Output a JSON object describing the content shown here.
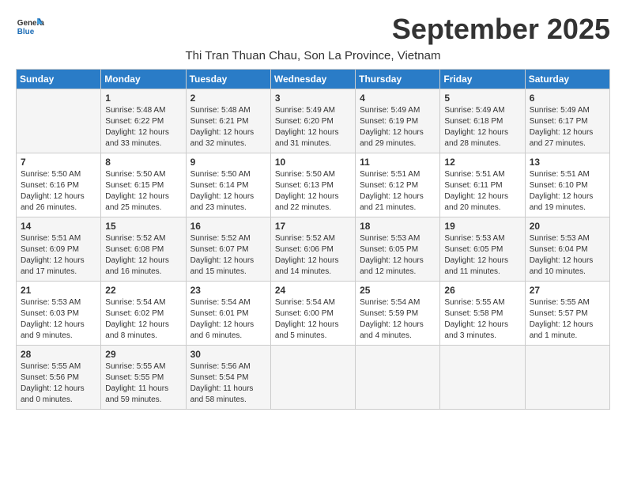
{
  "logo": {
    "line1": "General",
    "line2": "Blue"
  },
  "title": "September 2025",
  "location": "Thi Tran Thuan Chau, Son La Province, Vietnam",
  "days_of_week": [
    "Sunday",
    "Monday",
    "Tuesday",
    "Wednesday",
    "Thursday",
    "Friday",
    "Saturday"
  ],
  "weeks": [
    [
      {
        "day": "",
        "info": ""
      },
      {
        "day": "1",
        "info": "Sunrise: 5:48 AM\nSunset: 6:22 PM\nDaylight: 12 hours\nand 33 minutes."
      },
      {
        "day": "2",
        "info": "Sunrise: 5:48 AM\nSunset: 6:21 PM\nDaylight: 12 hours\nand 32 minutes."
      },
      {
        "day": "3",
        "info": "Sunrise: 5:49 AM\nSunset: 6:20 PM\nDaylight: 12 hours\nand 31 minutes."
      },
      {
        "day": "4",
        "info": "Sunrise: 5:49 AM\nSunset: 6:19 PM\nDaylight: 12 hours\nand 29 minutes."
      },
      {
        "day": "5",
        "info": "Sunrise: 5:49 AM\nSunset: 6:18 PM\nDaylight: 12 hours\nand 28 minutes."
      },
      {
        "day": "6",
        "info": "Sunrise: 5:49 AM\nSunset: 6:17 PM\nDaylight: 12 hours\nand 27 minutes."
      }
    ],
    [
      {
        "day": "7",
        "info": "Sunrise: 5:50 AM\nSunset: 6:16 PM\nDaylight: 12 hours\nand 26 minutes."
      },
      {
        "day": "8",
        "info": "Sunrise: 5:50 AM\nSunset: 6:15 PM\nDaylight: 12 hours\nand 25 minutes."
      },
      {
        "day": "9",
        "info": "Sunrise: 5:50 AM\nSunset: 6:14 PM\nDaylight: 12 hours\nand 23 minutes."
      },
      {
        "day": "10",
        "info": "Sunrise: 5:50 AM\nSunset: 6:13 PM\nDaylight: 12 hours\nand 22 minutes."
      },
      {
        "day": "11",
        "info": "Sunrise: 5:51 AM\nSunset: 6:12 PM\nDaylight: 12 hours\nand 21 minutes."
      },
      {
        "day": "12",
        "info": "Sunrise: 5:51 AM\nSunset: 6:11 PM\nDaylight: 12 hours\nand 20 minutes."
      },
      {
        "day": "13",
        "info": "Sunrise: 5:51 AM\nSunset: 6:10 PM\nDaylight: 12 hours\nand 19 minutes."
      }
    ],
    [
      {
        "day": "14",
        "info": "Sunrise: 5:51 AM\nSunset: 6:09 PM\nDaylight: 12 hours\nand 17 minutes."
      },
      {
        "day": "15",
        "info": "Sunrise: 5:52 AM\nSunset: 6:08 PM\nDaylight: 12 hours\nand 16 minutes."
      },
      {
        "day": "16",
        "info": "Sunrise: 5:52 AM\nSunset: 6:07 PM\nDaylight: 12 hours\nand 15 minutes."
      },
      {
        "day": "17",
        "info": "Sunrise: 5:52 AM\nSunset: 6:06 PM\nDaylight: 12 hours\nand 14 minutes."
      },
      {
        "day": "18",
        "info": "Sunrise: 5:53 AM\nSunset: 6:05 PM\nDaylight: 12 hours\nand 12 minutes."
      },
      {
        "day": "19",
        "info": "Sunrise: 5:53 AM\nSunset: 6:05 PM\nDaylight: 12 hours\nand 11 minutes."
      },
      {
        "day": "20",
        "info": "Sunrise: 5:53 AM\nSunset: 6:04 PM\nDaylight: 12 hours\nand 10 minutes."
      }
    ],
    [
      {
        "day": "21",
        "info": "Sunrise: 5:53 AM\nSunset: 6:03 PM\nDaylight: 12 hours\nand 9 minutes."
      },
      {
        "day": "22",
        "info": "Sunrise: 5:54 AM\nSunset: 6:02 PM\nDaylight: 12 hours\nand 8 minutes."
      },
      {
        "day": "23",
        "info": "Sunrise: 5:54 AM\nSunset: 6:01 PM\nDaylight: 12 hours\nand 6 minutes."
      },
      {
        "day": "24",
        "info": "Sunrise: 5:54 AM\nSunset: 6:00 PM\nDaylight: 12 hours\nand 5 minutes."
      },
      {
        "day": "25",
        "info": "Sunrise: 5:54 AM\nSunset: 5:59 PM\nDaylight: 12 hours\nand 4 minutes."
      },
      {
        "day": "26",
        "info": "Sunrise: 5:55 AM\nSunset: 5:58 PM\nDaylight: 12 hours\nand 3 minutes."
      },
      {
        "day": "27",
        "info": "Sunrise: 5:55 AM\nSunset: 5:57 PM\nDaylight: 12 hours\nand 1 minute."
      }
    ],
    [
      {
        "day": "28",
        "info": "Sunrise: 5:55 AM\nSunset: 5:56 PM\nDaylight: 12 hours\nand 0 minutes."
      },
      {
        "day": "29",
        "info": "Sunrise: 5:55 AM\nSunset: 5:55 PM\nDaylight: 11 hours\nand 59 minutes."
      },
      {
        "day": "30",
        "info": "Sunrise: 5:56 AM\nSunset: 5:54 PM\nDaylight: 11 hours\nand 58 minutes."
      },
      {
        "day": "",
        "info": ""
      },
      {
        "day": "",
        "info": ""
      },
      {
        "day": "",
        "info": ""
      },
      {
        "day": "",
        "info": ""
      }
    ]
  ]
}
